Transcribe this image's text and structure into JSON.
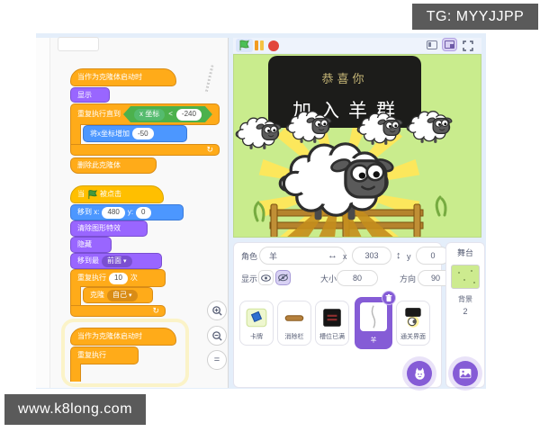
{
  "badges": {
    "tg": "TG: MYYJJPP",
    "watermark": "www.k8long.com"
  },
  "scene": {
    "banner_line1": "恭喜你",
    "banner_line2": "加入羊群"
  },
  "sprite_info": {
    "name_label": "角色",
    "name_value": "羊",
    "x_label": "x",
    "x_value": "303",
    "y_label": "y",
    "y_value": "0",
    "show_label": "显示",
    "size_label": "大小",
    "size_value": "80",
    "direction_label": "方向",
    "direction_value": "90"
  },
  "sprite_list": {
    "sprites": [
      {
        "name": "卡牌",
        "selected": false
      },
      {
        "name": "消除栏",
        "selected": false
      },
      {
        "name": "槽位已满",
        "selected": false
      },
      {
        "name": "羊",
        "selected": true
      },
      {
        "name": "通关界面",
        "selected": false
      }
    ]
  },
  "stage_panel": {
    "title": "舞台",
    "backdrops_label": "背景",
    "backdrops_count": "2"
  },
  "code": {
    "script1": {
      "hat": "当作为克隆体启动时",
      "show": "显示",
      "repeat_until": "重复执行直到",
      "condition_reporter": "x 坐标",
      "condition_op": "<",
      "condition_value": "-240",
      "change_x": "将x坐标增加",
      "change_x_value": "-50",
      "delete_clone": "删除此克隆体"
    },
    "script2": {
      "hat_prefix": "当",
      "hat_suffix": "被点击",
      "goto_label": "移到 x:",
      "goto_x": "480",
      "goto_y_label": "y:",
      "goto_y": "0",
      "clear_effects": "清除图形特效",
      "hide": "隐藏",
      "go_layer_label": "移到最",
      "go_layer_value": "前面",
      "repeat_label": "重复执行",
      "repeat_times": "10",
      "repeat_suffix": "次",
      "clone_label": "克隆",
      "clone_target": "自己"
    },
    "script3": {
      "hat": "当作为克隆体启动时",
      "forever": "重复执行"
    }
  }
}
